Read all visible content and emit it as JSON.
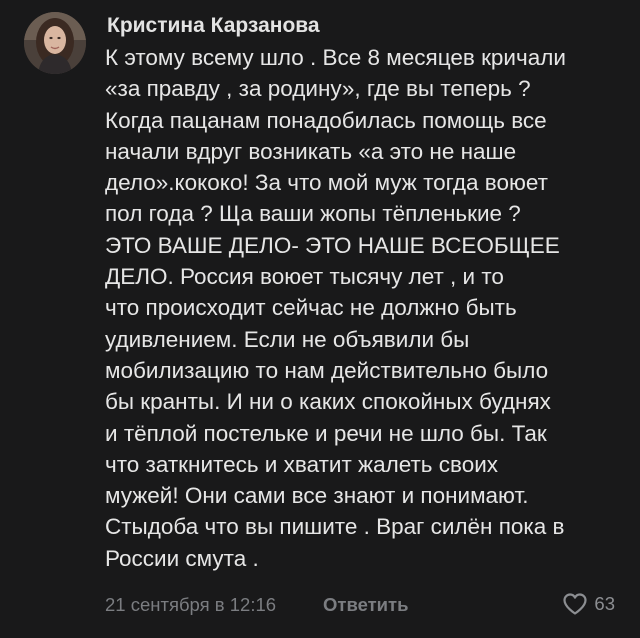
{
  "comment": {
    "author": "Кристина Карзанова",
    "text_lines": [
      "К этому всему шло . Все 8 месяцев кричали",
      "«за правду , за родину», где вы теперь ?",
      "Когда пацанам понадобилась помощь все",
      "начали вдруг возникать «а это не наше",
      "дело».кококо! За что мой муж тогда воюет",
      "пол года ? Ща ваши жопы тёпленькие ?",
      "ЭТО ВАШЕ ДЕЛО- ЭТО НАШЕ ВСЕОБЩЕЕ",
      "ДЕЛО. Россия воюет тысячу лет , и то",
      "что происходит сейчас не должно быть",
      "удивлением. Если не объявили бы",
      "мобилизацию то нам действительно было",
      "бы кранты. И ни о каких спокойных буднях",
      "и тёплой постельке и речи не шло бы. Так",
      "что заткнитесь и хватит жалеть своих",
      "мужей! Они сами все знают и понимают.",
      "Стыдоба что вы пишите . Враг силён пока в",
      "России смута ."
    ],
    "timestamp": "21 сентября в 12:16",
    "reply_label": "Ответить",
    "like_count": "63"
  },
  "icons": {
    "avatar": "user-photo-avatar",
    "like": "heart-outline-icon"
  },
  "colors": {
    "background": "#19191a",
    "text": "#e6e6e6",
    "author": "#e3e3e3",
    "secondary": "#7b7d81"
  }
}
